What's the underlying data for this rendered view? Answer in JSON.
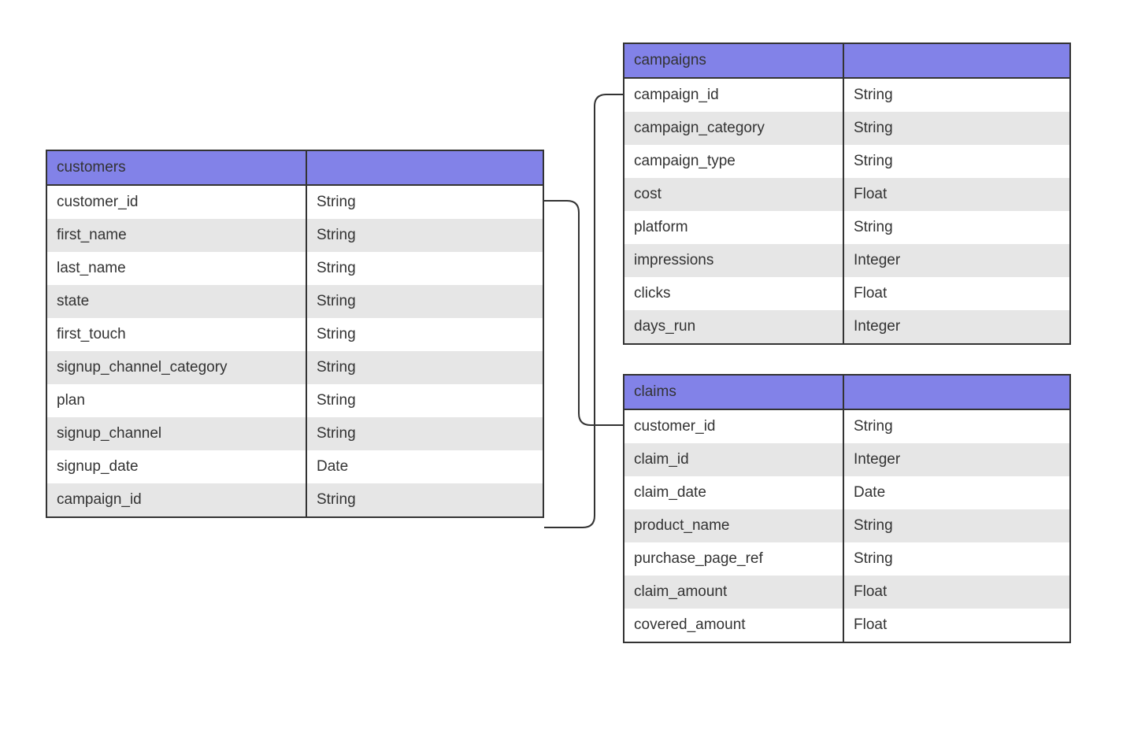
{
  "tables": {
    "customers": {
      "name": "customers",
      "columns": [
        {
          "name": "customer_id",
          "type": "String"
        },
        {
          "name": "first_name",
          "type": "String"
        },
        {
          "name": "last_name",
          "type": "String"
        },
        {
          "name": "state",
          "type": "String"
        },
        {
          "name": "first_touch",
          "type": "String"
        },
        {
          "name": "signup_channel_category",
          "type": "String"
        },
        {
          "name": "plan",
          "type": "String"
        },
        {
          "name": "signup_channel",
          "type": "String"
        },
        {
          "name": "signup_date",
          "type": "Date"
        },
        {
          "name": "campaign_id",
          "type": "String"
        }
      ]
    },
    "campaigns": {
      "name": "campaigns",
      "columns": [
        {
          "name": "campaign_id",
          "type": "String"
        },
        {
          "name": "campaign_category",
          "type": "String"
        },
        {
          "name": "campaign_type",
          "type": "String"
        },
        {
          "name": "cost",
          "type": "Float"
        },
        {
          "name": "platform",
          "type": "String"
        },
        {
          "name": "impressions",
          "type": "Integer"
        },
        {
          "name": "clicks",
          "type": "Float"
        },
        {
          "name": "days_run",
          "type": "Integer"
        }
      ]
    },
    "claims": {
      "name": "claims",
      "columns": [
        {
          "name": "customer_id",
          "type": "String"
        },
        {
          "name": "claim_id",
          "type": "Integer"
        },
        {
          "name": "claim_date",
          "type": "Date"
        },
        {
          "name": "product_name",
          "type": "String"
        },
        {
          "name": "purchase_page_ref",
          "type": "String"
        },
        {
          "name": "claim_amount",
          "type": "Float"
        },
        {
          "name": "covered_amount",
          "type": "Float"
        }
      ]
    }
  },
  "relationships": [
    {
      "from_table": "customers",
      "from_column": "customer_id",
      "to_table": "claims",
      "to_column": "customer_id"
    },
    {
      "from_table": "customers",
      "from_column": "campaign_id",
      "to_table": "campaigns",
      "to_column": "campaign_id"
    }
  ]
}
